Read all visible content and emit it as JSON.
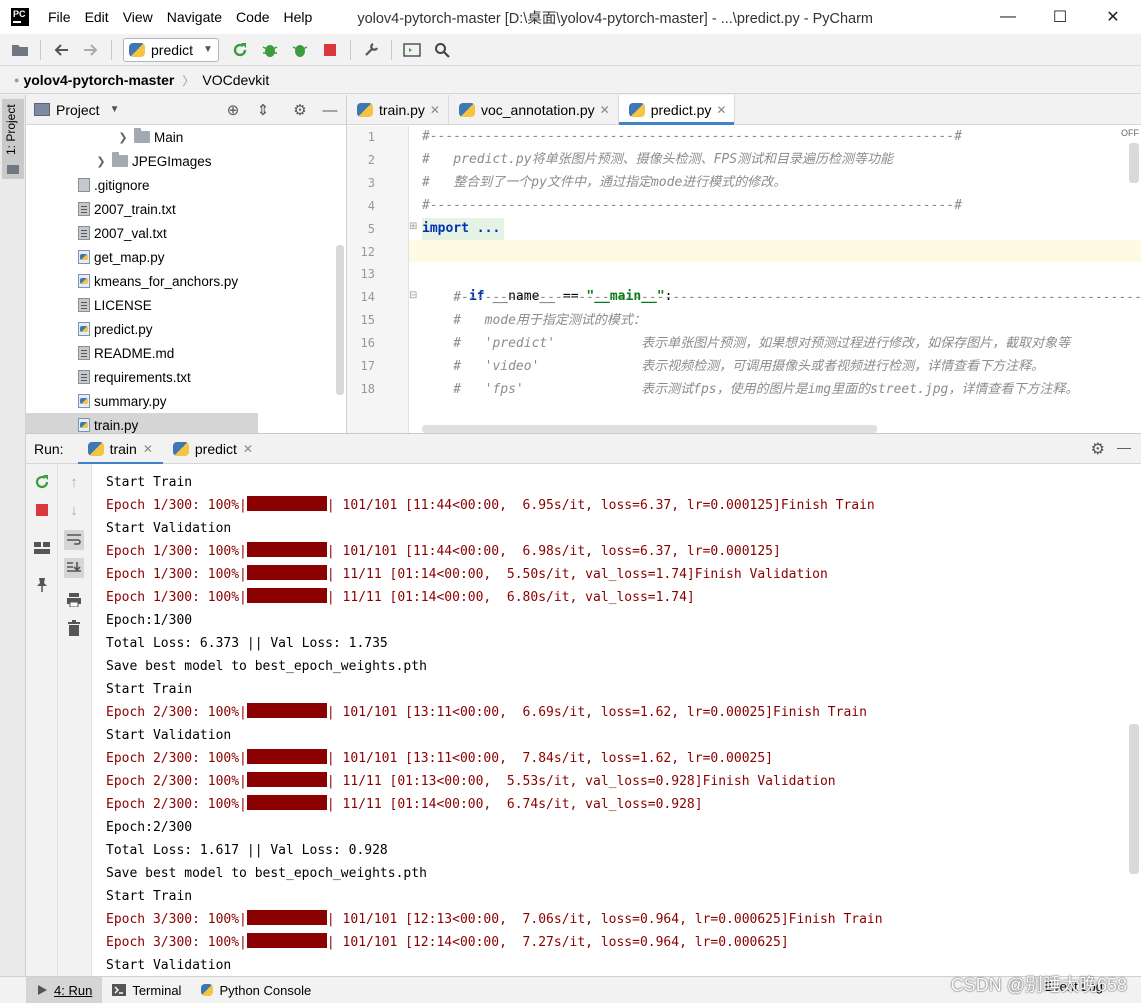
{
  "window": {
    "logo_text": "PC",
    "menu": [
      "File",
      "Edit",
      "View",
      "Navigate",
      "Code",
      "Help"
    ],
    "title": "yolov4-pytorch-master [D:\\桌面\\yolov4-pytorch-master] - ...\\predict.py - PyCharm",
    "minimize": "—",
    "maximize": "☐",
    "close": "✕"
  },
  "toolbar": {
    "run_config": "predict"
  },
  "breadcrumb": [
    "yolov4-pytorch-master",
    "VOCdevkit"
  ],
  "left_strip": {
    "project_label": "1: Project"
  },
  "project": {
    "title": "Project",
    "tree": [
      {
        "name": "Main",
        "type": "folder",
        "indent": 2,
        "arrow": "❯"
      },
      {
        "name": "JPEGImages",
        "type": "folder",
        "indent": 1,
        "arrow": "❯"
      },
      {
        "name": ".gitignore",
        "type": "file"
      },
      {
        "name": "2007_train.txt",
        "type": "txt"
      },
      {
        "name": "2007_val.txt",
        "type": "txt"
      },
      {
        "name": "get_map.py",
        "type": "py"
      },
      {
        "name": "kmeans_for_anchors.py",
        "type": "py"
      },
      {
        "name": "LICENSE",
        "type": "txt"
      },
      {
        "name": "predict.py",
        "type": "py"
      },
      {
        "name": "README.md",
        "type": "txt"
      },
      {
        "name": "requirements.txt",
        "type": "txt"
      },
      {
        "name": "summary.py",
        "type": "py"
      },
      {
        "name": "train.py",
        "type": "py",
        "selected": true
      }
    ]
  },
  "editor": {
    "tabs": [
      {
        "label": "train.py",
        "active": false
      },
      {
        "label": "voc_annotation.py",
        "active": false
      },
      {
        "label": "predict.py",
        "active": true
      }
    ],
    "off_label": "OFF",
    "lines": [
      {
        "n": "1",
        "text": "#-------------------------------------------------------------------#",
        "cls": "cmt"
      },
      {
        "n": "2",
        "text": "#   predict.py将单张图片预测、摄像头检测、FPS测试和目录遍历检测等功能",
        "cls": "cmt"
      },
      {
        "n": "3",
        "text": "#   整合到了一个py文件中，通过指定mode进行模式的修改。",
        "cls": "cmt"
      },
      {
        "n": "4",
        "text": "#-------------------------------------------------------------------#",
        "cls": "cmt"
      },
      {
        "n": "5",
        "text": "import ...",
        "cls": "import"
      },
      {
        "n": "12",
        "text": "",
        "cls": ""
      },
      {
        "n": "13",
        "text": "main",
        "cls": "main"
      },
      {
        "n": "14",
        "text": "    #----------------------------------------------------------------------------------------------------------",
        "cls": "cmt"
      },
      {
        "n": "15",
        "text": "    #   mode用于指定测试的模式：",
        "cls": "cmt"
      },
      {
        "n": "16",
        "text": "    #   'predict'           表示单张图片预测，如果想对预测过程进行修改，如保存图片，截取对象等",
        "cls": "cmt"
      },
      {
        "n": "17",
        "text": "    #   'video'             表示视频检测，可调用摄像头或者视频进行检测，详情查看下方注释。",
        "cls": "cmt"
      },
      {
        "n": "18",
        "text": "    #   'fps'               表示测试fps，使用的图片是img里面的street.jpg，详情查看下方注释。",
        "cls": "cmt"
      }
    ],
    "main_parts": {
      "kw": "if",
      "mid": " __name__ == ",
      "str": "\"__main__\"",
      "end": ":"
    }
  },
  "run": {
    "label": "Run:",
    "tabs": [
      {
        "label": "train",
        "active": true
      },
      {
        "label": "predict",
        "active": false
      }
    ],
    "console": [
      {
        "t": "out",
        "text": "Start Train"
      },
      {
        "t": "err",
        "pre": "Epoch 1/300: 100%|",
        "post": "| 101/101 [11:44<00:00,  6.95s/it, loss=6.37, lr=0.000125]Finish Train"
      },
      {
        "t": "out",
        "text": "Start Validation"
      },
      {
        "t": "err",
        "pre": "Epoch 1/300: 100%|",
        "post": "| 101/101 [11:44<00:00,  6.98s/it, loss=6.37, lr=0.000125]"
      },
      {
        "t": "err",
        "pre": "Epoch 1/300: 100%|",
        "post": "| 11/11 [01:14<00:00,  5.50s/it, val_loss=1.74]Finish Validation"
      },
      {
        "t": "err",
        "pre": "Epoch 1/300: 100%|",
        "post": "| 11/11 [01:14<00:00,  6.80s/it, val_loss=1.74]"
      },
      {
        "t": "out",
        "text": "Epoch:1/300"
      },
      {
        "t": "out",
        "text": "Total Loss: 6.373 || Val Loss: 1.735 "
      },
      {
        "t": "out",
        "text": "Save best model to best_epoch_weights.pth"
      },
      {
        "t": "out",
        "text": "Start Train"
      },
      {
        "t": "err",
        "pre": "Epoch 2/300: 100%|",
        "post": "| 101/101 [13:11<00:00,  6.69s/it, loss=1.62, lr=0.00025]Finish Train"
      },
      {
        "t": "out",
        "text": "Start Validation"
      },
      {
        "t": "err",
        "pre": "Epoch 2/300: 100%|",
        "post": "| 101/101 [13:11<00:00,  7.84s/it, loss=1.62, lr=0.00025]"
      },
      {
        "t": "err",
        "pre": "Epoch 2/300: 100%|",
        "post": "| 11/11 [01:13<00:00,  5.53s/it, val_loss=0.928]Finish Validation"
      },
      {
        "t": "err",
        "pre": "Epoch 2/300: 100%|",
        "post": "| 11/11 [01:14<00:00,  6.74s/it, val_loss=0.928]"
      },
      {
        "t": "out",
        "text": "Epoch:2/300"
      },
      {
        "t": "out",
        "text": "Total Loss: 1.617 || Val Loss: 0.928 "
      },
      {
        "t": "out",
        "text": "Save best model to best_epoch_weights.pth"
      },
      {
        "t": "out",
        "text": "Start Train"
      },
      {
        "t": "err",
        "pre": "Epoch 3/300: 100%|",
        "post": "| 101/101 [12:13<00:00,  7.06s/it, loss=0.964, lr=0.000625]Finish Train"
      },
      {
        "t": "err",
        "pre": "Epoch 3/300: 100%|",
        "post": "| 101/101 [12:14<00:00,  7.27s/it, loss=0.964, lr=0.000625]"
      },
      {
        "t": "out",
        "text": "Start Validation"
      }
    ]
  },
  "bottom": {
    "tabs": [
      {
        "label": "4: Run",
        "active": true
      },
      {
        "label": "Terminal",
        "active": false
      },
      {
        "label": "Python Console",
        "active": false
      }
    ],
    "event_log": "Event Log",
    "watermark": "CSDN @别睡太晚658"
  },
  "colors": {
    "accent": "#4083c9",
    "console_error": "#8b0000",
    "keyword": "#0033b3",
    "string": "#067d17",
    "comment": "#8c8c8c"
  }
}
